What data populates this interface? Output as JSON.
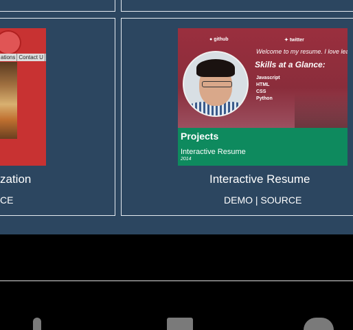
{
  "projects": [
    {
      "title": "zation",
      "links": {
        "demo": "",
        "source": "CE"
      },
      "thumbnail": {
        "nav_items": [
          "ations",
          "Contact U"
        ]
      }
    },
    {
      "title": "Interactive Resume",
      "links": {
        "demo": "DEMO",
        "separator": "|",
        "source": "SOURCE"
      },
      "thumbnail": {
        "github": "github",
        "twitter": "twitter",
        "welcome": "Welcome to my resume. I love lea",
        "skills_heading": "Skills at a Glance:",
        "skills": [
          "Javascript",
          "HTML",
          "CSS",
          "Python"
        ],
        "projects_heading": "Projects",
        "project_title": "Interactive Resume",
        "project_year": "2014"
      }
    }
  ],
  "footer_icons": [
    "phone-icon",
    "image-icon",
    "github-icon"
  ],
  "colors": {
    "portfolio_bg": "#2c4660",
    "footer_bg": "#000000",
    "resume_red": "#8a2d3b",
    "resume_green": "#0e8a5e"
  }
}
